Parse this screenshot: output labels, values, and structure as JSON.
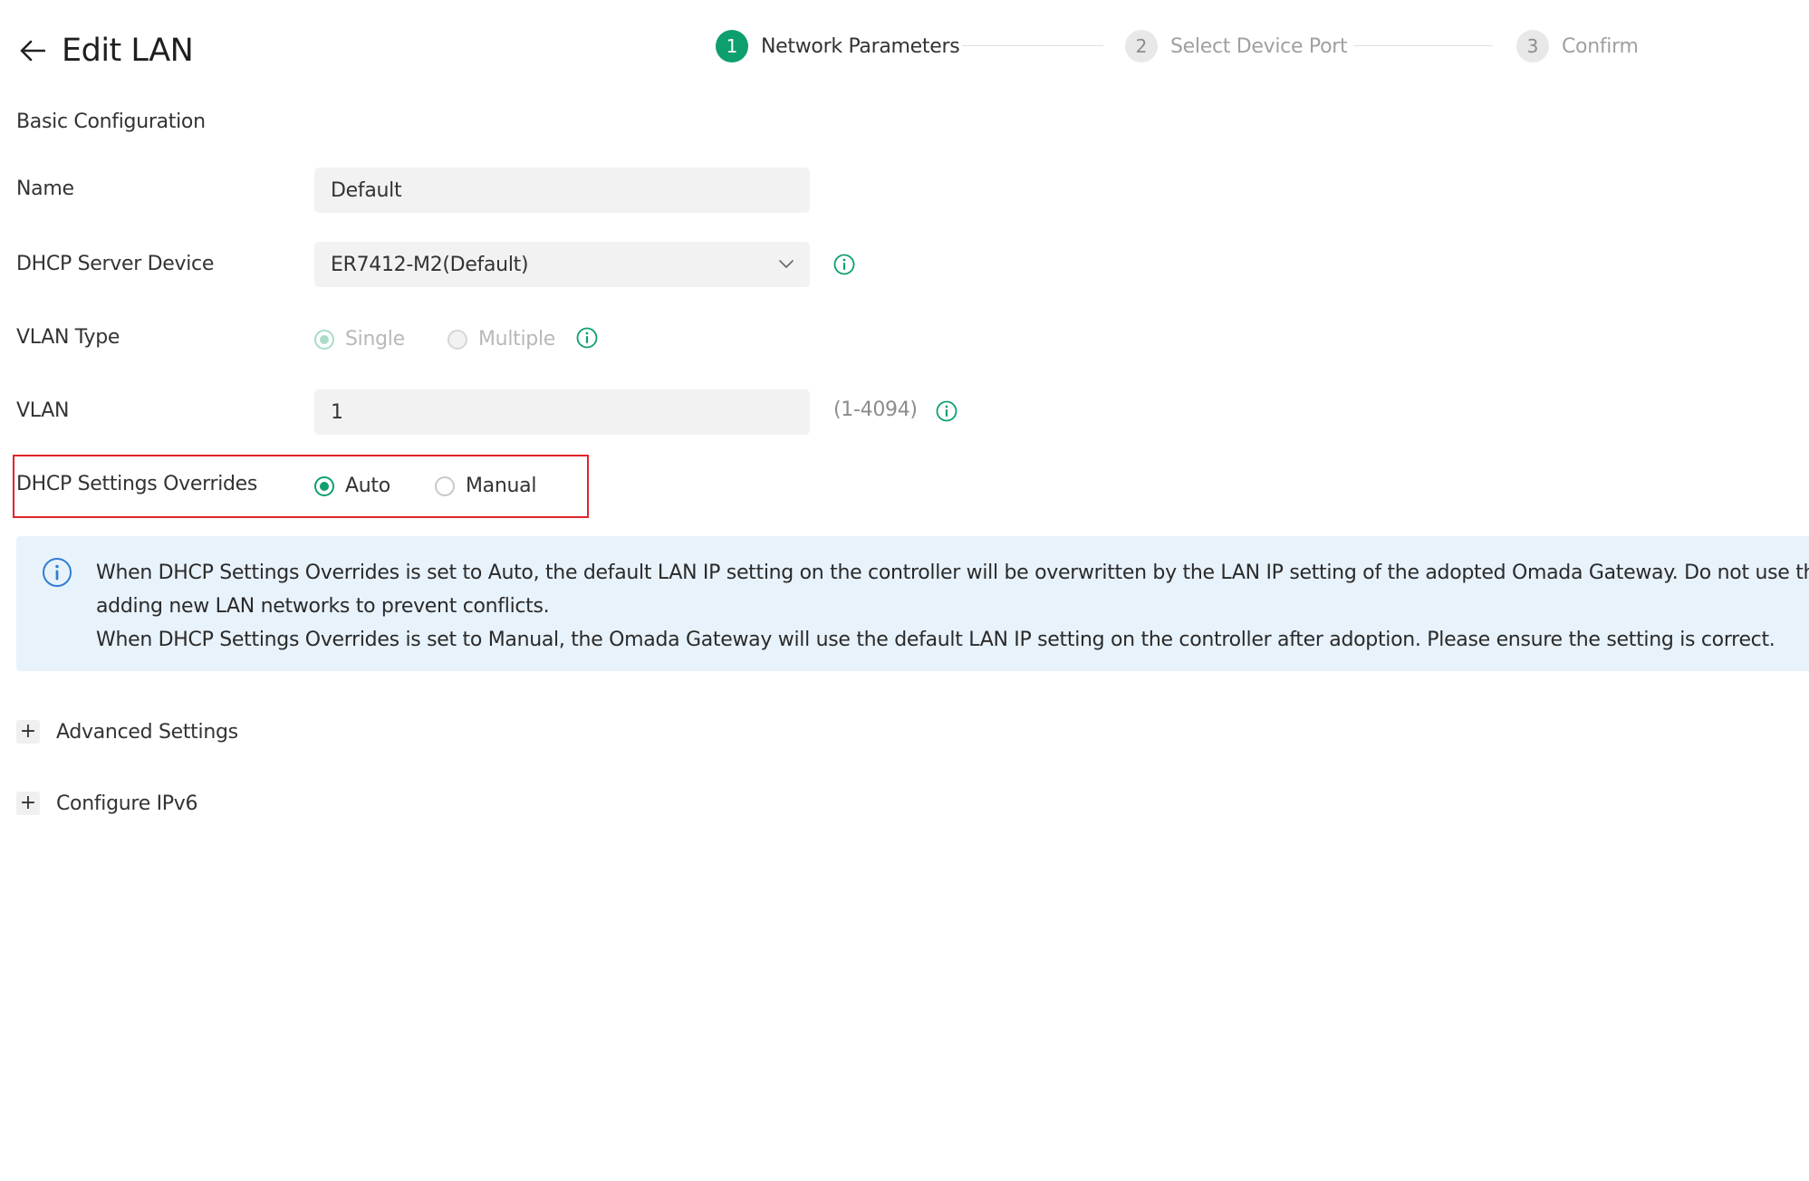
{
  "header": {
    "title": "Edit LAN"
  },
  "stepper": {
    "steps": [
      {
        "number": "1",
        "label": "Network Parameters",
        "state": "active"
      },
      {
        "number": "2",
        "label": "Select Device Port",
        "state": "pending"
      },
      {
        "number": "3",
        "label": "Confirm",
        "state": "pending"
      }
    ]
  },
  "form": {
    "section_title": "Basic Configuration",
    "name": {
      "label": "Name",
      "value": "Default"
    },
    "dhcp_server_device": {
      "label": "DHCP Server Device",
      "value": "ER7412-M2(Default)"
    },
    "vlan_type": {
      "label": "VLAN Type",
      "options": [
        "Single",
        "Multiple"
      ],
      "selected": "Single",
      "disabled": true
    },
    "vlan": {
      "label": "VLAN",
      "value": "1",
      "hint": "(1-4094)"
    },
    "dhcp_settings_overrides": {
      "label": "DHCP Settings Overrides",
      "options": [
        "Auto",
        "Manual"
      ],
      "selected": "Auto"
    }
  },
  "info_banner": {
    "lines": [
      "When DHCP Settings Overrides is set to Auto, the default LAN IP setting on the controller will be overwritten by the LAN IP setting of the adopted Omada Gateway. Do not use the same network segment when",
      "adding new LAN networks to prevent conflicts.",
      "When DHCP Settings Overrides is set to Manual, the Omada Gateway will use the default LAN IP setting on the controller after adoption. Please ensure the setting is correct."
    ]
  },
  "collapsibles": {
    "advanced_settings": "Advanced Settings",
    "configure_ipv6": "Configure IPv6",
    "expand_symbol": "+"
  },
  "colors": {
    "accent": "#0e9f6e",
    "highlight_border": "#e0242b",
    "banner_background": "#e8f2fb",
    "info_blue": "#2f7fd1"
  },
  "icons": {
    "back": "arrow-left-icon",
    "select": "chevron-down-icon",
    "field_info": "info-circle-icon",
    "banner_info": "info-circle-icon",
    "expand": "plus-icon"
  }
}
